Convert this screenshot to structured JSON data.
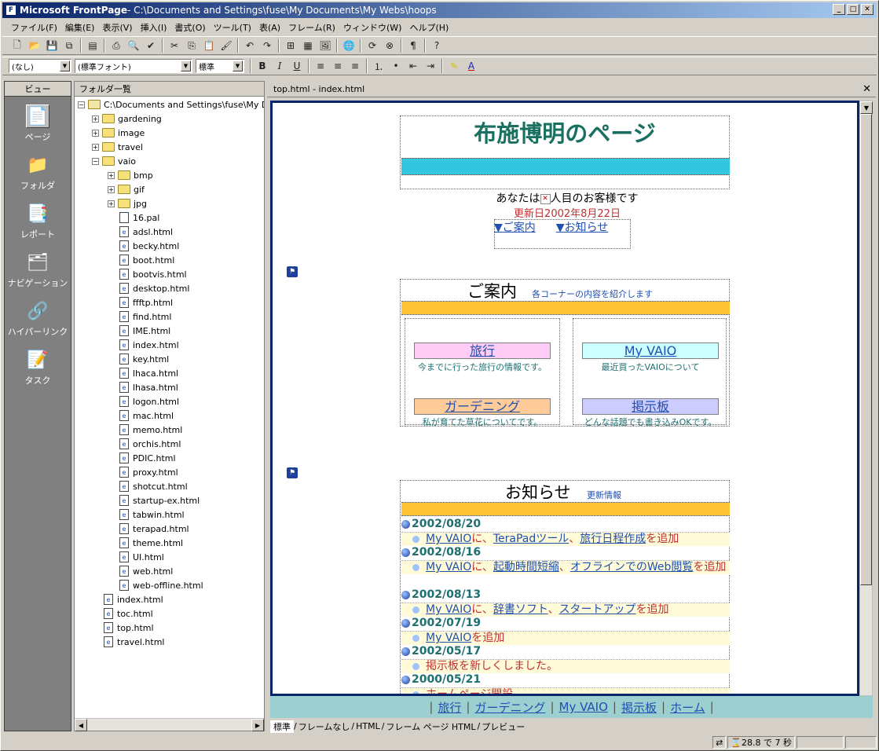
{
  "window": {
    "app": "Microsoft FrontPage",
    "caption": " - C:\\Documents and Settings\\fuse\\My Documents\\My Webs\\hoops"
  },
  "menu": [
    "ファイル(F)",
    "編集(E)",
    "表示(V)",
    "挿入(I)",
    "書式(O)",
    "ツール(T)",
    "表(A)",
    "フレーム(R)",
    "ウィンドウ(W)",
    "ヘルプ(H)"
  ],
  "format": {
    "style": "(なし)",
    "font": "(標準フォント)",
    "size": "標準"
  },
  "views": {
    "title": "ビュー",
    "items": [
      {
        "label": "ページ",
        "icon": "page-icon"
      },
      {
        "label": "フォルダ",
        "icon": "folder-icon"
      },
      {
        "label": "レポート",
        "icon": "report-icon"
      },
      {
        "label": "ナビゲーション",
        "icon": "navigation-icon"
      },
      {
        "label": "ハイパーリンク",
        "icon": "hyperlink-icon"
      },
      {
        "label": "タスク",
        "icon": "task-icon"
      }
    ]
  },
  "folders": {
    "title": "フォルダ一覧",
    "root": "C:\\Documents and Settings\\fuse\\My D",
    "items": [
      {
        "t": "f",
        "exp": "+",
        "name": "gardening",
        "lvl": 1
      },
      {
        "t": "f",
        "exp": "+",
        "name": "image",
        "lvl": 1
      },
      {
        "t": "f",
        "exp": "+",
        "name": "travel",
        "lvl": 1
      },
      {
        "t": "f",
        "exp": "-",
        "name": "vaio",
        "lvl": 1
      },
      {
        "t": "f",
        "exp": "+",
        "name": "bmp",
        "lvl": 2
      },
      {
        "t": "f",
        "exp": "+",
        "name": "gif",
        "lvl": 2
      },
      {
        "t": "f",
        "exp": "+",
        "name": "jpg",
        "lvl": 2
      },
      {
        "t": "p",
        "name": "16.pal",
        "lvl": 2
      },
      {
        "t": "p",
        "name": "adsl.html",
        "lvl": 2
      },
      {
        "t": "p",
        "name": "becky.html",
        "lvl": 2
      },
      {
        "t": "p",
        "name": "boot.html",
        "lvl": 2
      },
      {
        "t": "p",
        "name": "bootvis.html",
        "lvl": 2
      },
      {
        "t": "p",
        "name": "desktop.html",
        "lvl": 2
      },
      {
        "t": "p",
        "name": "ffftp.html",
        "lvl": 2
      },
      {
        "t": "p",
        "name": "find.html",
        "lvl": 2
      },
      {
        "t": "p",
        "name": "IME.html",
        "lvl": 2
      },
      {
        "t": "p",
        "name": "index.html",
        "lvl": 2
      },
      {
        "t": "p",
        "name": "key.html",
        "lvl": 2
      },
      {
        "t": "p",
        "name": "lhaca.html",
        "lvl": 2
      },
      {
        "t": "p",
        "name": "lhasa.html",
        "lvl": 2
      },
      {
        "t": "p",
        "name": "logon.html",
        "lvl": 2
      },
      {
        "t": "p",
        "name": "mac.html",
        "lvl": 2
      },
      {
        "t": "p",
        "name": "memo.html",
        "lvl": 2
      },
      {
        "t": "p",
        "name": "orchis.html",
        "lvl": 2
      },
      {
        "t": "p",
        "name": "PDIC.html",
        "lvl": 2
      },
      {
        "t": "p",
        "name": "proxy.html",
        "lvl": 2
      },
      {
        "t": "p",
        "name": "shotcut.html",
        "lvl": 2
      },
      {
        "t": "p",
        "name": "startup-ex.html",
        "lvl": 2
      },
      {
        "t": "p",
        "name": "tabwin.html",
        "lvl": 2
      },
      {
        "t": "p",
        "name": "terapad.html",
        "lvl": 2
      },
      {
        "t": "p",
        "name": "theme.html",
        "lvl": 2
      },
      {
        "t": "p",
        "name": "UI.html",
        "lvl": 2
      },
      {
        "t": "p",
        "name": "web.html",
        "lvl": 2
      },
      {
        "t": "p",
        "name": "web-offline.html",
        "lvl": 2
      },
      {
        "t": "p",
        "name": "index.html",
        "lvl": 1
      },
      {
        "t": "p",
        "name": "toc.html",
        "lvl": 1
      },
      {
        "t": "p",
        "name": "top.html",
        "lvl": 1
      },
      {
        "t": "p",
        "name": "travel.html",
        "lvl": 1
      }
    ]
  },
  "editor": {
    "tab_title": "top.html - index.html"
  },
  "page": {
    "title": "布施博明のページ",
    "visitor_pre": "あなたは",
    "visitor_post": "人目のお客様です",
    "updated": "更新日2002年8月22日",
    "anchor1": "▼ご案内",
    "anchor2": "▼お知らせ",
    "guide_heading": "ご案内",
    "guide_sub": "各コーナーの内容を紹介します",
    "nav": [
      {
        "label": "旅行",
        "desc": "今までに行った旅行の情報です。",
        "color": "#ffccf5"
      },
      {
        "label": "My VAIO",
        "desc": "最近買ったVAIOについて",
        "color": "#ccffff"
      },
      {
        "label": "ガーデニング",
        "desc": "私が育てた草花についてです。",
        "color": "#ffcc99"
      },
      {
        "label": "掲示板",
        "desc": "どんな話題でも書き込みOKです。",
        "color": "#ccccff"
      }
    ],
    "news_heading": "お知らせ",
    "news_sub": "更新情報",
    "news": [
      {
        "date": "2002/08/20",
        "parts": [
          [
            "My VAIO",
            1
          ],
          [
            "に、",
            0
          ],
          [
            "TeraPadツール",
            1
          ],
          [
            "、",
            0
          ],
          [
            "旅行日程作成",
            1
          ],
          [
            "を追加",
            0
          ]
        ]
      },
      {
        "date": "2002/08/16",
        "parts": [
          [
            "My VAIO",
            1
          ],
          [
            "に、",
            0
          ],
          [
            "起動時間短縮",
            1
          ],
          [
            "、",
            0
          ],
          [
            "オフラインでのWeb閲覧",
            1
          ],
          [
            "を追加",
            0
          ]
        ]
      },
      {
        "date": "2002/08/13",
        "parts": [
          [
            "My VAIO",
            1
          ],
          [
            "に、",
            0
          ],
          [
            "辞書ソフト",
            1
          ],
          [
            "、",
            0
          ],
          [
            "スタートアップ",
            1
          ],
          [
            "を追加",
            0
          ]
        ]
      },
      {
        "date": "2002/07/19",
        "parts": [
          [
            "My VAIO",
            1
          ],
          [
            "を追加",
            0
          ]
        ]
      },
      {
        "date": "2002/05/17",
        "parts": [
          [
            "掲示板を新しくしました。",
            0
          ]
        ]
      },
      {
        "date": "2000/05/21",
        "parts": [
          [
            "ホームページ開設",
            0
          ]
        ]
      }
    ],
    "footer": [
      "旅行",
      "ガーデニング",
      "My VAIO",
      "掲示板",
      "ホーム"
    ]
  },
  "view_tabs": [
    "標準",
    "フレームなし",
    "HTML",
    "フレーム ページ HTML",
    "プレビュー"
  ],
  "status": {
    "time": "28.8 で 7 秒"
  }
}
